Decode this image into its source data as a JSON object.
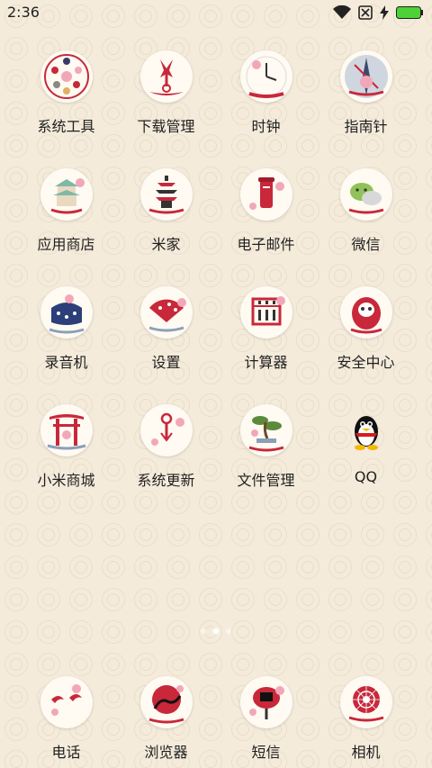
{
  "status": {
    "time": "2:36"
  },
  "apps": [
    {
      "label": "系统工具",
      "icon": "system-tools-icon"
    },
    {
      "label": "下载管理",
      "icon": "download-manager-icon"
    },
    {
      "label": "时钟",
      "icon": "clock-icon"
    },
    {
      "label": "指南针",
      "icon": "compass-icon"
    },
    {
      "label": "应用商店",
      "icon": "app-store-icon"
    },
    {
      "label": "米家",
      "icon": "mijia-pagoda-icon"
    },
    {
      "label": "电子邮件",
      "icon": "email-mailbox-icon"
    },
    {
      "label": "微信",
      "icon": "wechat-icon"
    },
    {
      "label": "录音机",
      "icon": "recorder-icon"
    },
    {
      "label": "设置",
      "icon": "settings-fan-icon"
    },
    {
      "label": "计算器",
      "icon": "calculator-abacus-icon"
    },
    {
      "label": "安全中心",
      "icon": "security-daruma-icon"
    },
    {
      "label": "小米商城",
      "icon": "mi-store-torii-icon"
    },
    {
      "label": "系统更新",
      "icon": "system-update-icon"
    },
    {
      "label": "文件管理",
      "icon": "file-manager-bonsai-icon"
    },
    {
      "label": "QQ",
      "icon": "qq-penguin-icon"
    }
  ],
  "dock": [
    {
      "label": "电话",
      "icon": "phone-birds-icon"
    },
    {
      "label": "浏览器",
      "icon": "browser-sun-icon"
    },
    {
      "label": "短信",
      "icon": "messages-lantern-icon"
    },
    {
      "label": "相机",
      "icon": "camera-umbrella-icon"
    }
  ],
  "colors": {
    "accent_red": "#c8283a",
    "sakura_pink": "#f2a7b8",
    "battery_green": "#4cd137"
  }
}
